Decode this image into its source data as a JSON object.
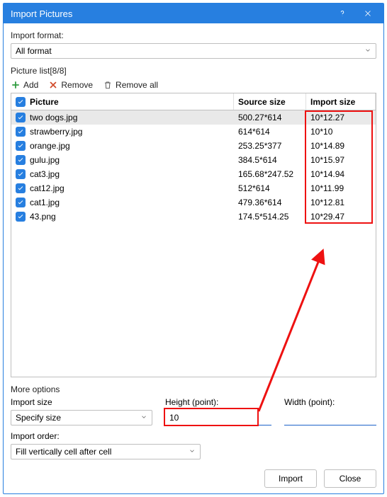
{
  "titlebar": {
    "title": "Import Pictures"
  },
  "format": {
    "label": "Import format:",
    "value": "All format"
  },
  "picture_list_label": "Picture list[8/8]",
  "toolbar": {
    "add": "Add",
    "remove": "Remove",
    "remove_all": "Remove all"
  },
  "table": {
    "headers": {
      "picture": "Picture",
      "source_size": "Source size",
      "import_size": "Import size"
    },
    "rows": [
      {
        "name": "two dogs.jpg",
        "source": "500.27*614",
        "import": "10*12.27",
        "checked": true,
        "selected": true
      },
      {
        "name": "strawberry.jpg",
        "source": "614*614",
        "import": "10*10",
        "checked": true,
        "selected": false
      },
      {
        "name": "orange.jpg",
        "source": "253.25*377",
        "import": "10*14.89",
        "checked": true,
        "selected": false
      },
      {
        "name": "gulu.jpg",
        "source": "384.5*614",
        "import": "10*15.97",
        "checked": true,
        "selected": false
      },
      {
        "name": "cat3.jpg",
        "source": "165.68*247.52",
        "import": "10*14.94",
        "checked": true,
        "selected": false
      },
      {
        "name": "cat12.jpg",
        "source": "512*614",
        "import": "10*11.99",
        "checked": true,
        "selected": false
      },
      {
        "name": "cat1.jpg",
        "source": "479.36*614",
        "import": "10*12.81",
        "checked": true,
        "selected": false
      },
      {
        "name": "43.png",
        "source": "174.5*514.25",
        "import": "10*29.47",
        "checked": true,
        "selected": false
      }
    ]
  },
  "more_options_label": "More options",
  "import_size": {
    "label": "Import size",
    "value": "Specify size"
  },
  "height": {
    "label": "Height (point):",
    "value": "10"
  },
  "width": {
    "label": "Width (point):",
    "value": ""
  },
  "import_order": {
    "label": "Import order:",
    "value": "Fill vertically cell after cell"
  },
  "footer": {
    "import": "Import",
    "close": "Close"
  }
}
